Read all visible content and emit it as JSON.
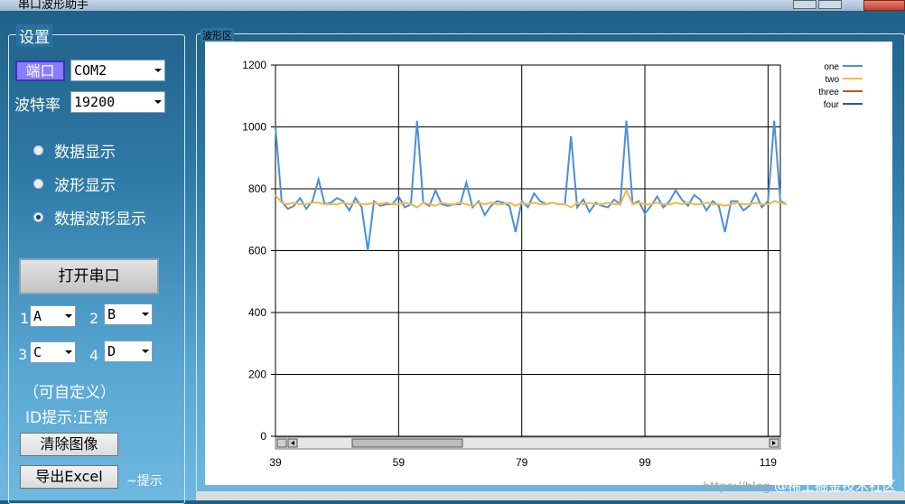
{
  "window": {
    "title": "串口波形助手"
  },
  "settings": {
    "legend": "设置",
    "port_button": "端口",
    "port_value": "COM2",
    "baud_label": "波特率",
    "baud_value": "19200",
    "radios": [
      {
        "label": "数据显示",
        "checked": false
      },
      {
        "label": "波形显示",
        "checked": false
      },
      {
        "label": "数据波形显示",
        "checked": true
      }
    ],
    "open_button": "打开串口",
    "channels": [
      {
        "num": "1",
        "value": "A"
      },
      {
        "num": "2",
        "value": "B"
      },
      {
        "num": "3",
        "value": "C"
      },
      {
        "num": "4",
        "value": "D"
      }
    ],
    "custom_note": "（可自定义）",
    "id_hint": "ID提示:正常",
    "clear_button": "清除图像",
    "export_button": "导出Excel",
    "tip_text": "~提示"
  },
  "waveform": {
    "legend": "波形区"
  },
  "watermark": {
    "url": "https://blog",
    "brand": "@稀土掘金技术社区"
  },
  "colors": {
    "one": "#4a90d9",
    "two": "#f5b942",
    "three": "#c8501e",
    "four": "#1f5f96"
  },
  "chart_data": {
    "type": "line",
    "x_ticks": [
      39,
      59,
      79,
      99,
      119
    ],
    "y_ticks": [
      0,
      200,
      400,
      600,
      800,
      1000,
      1200
    ],
    "xlim": [
      39,
      121
    ],
    "ylim": [
      0,
      1200
    ],
    "grid": true,
    "legend_position": "top-right",
    "series": [
      {
        "name": "one",
        "color": "#4a90d9",
        "values": [
          1000,
          760,
          735,
          745,
          770,
          735,
          760,
          830,
          750,
          755,
          770,
          760,
          730,
          770,
          740,
          600,
          760,
          745,
          750,
          750,
          775,
          740,
          750,
          1020,
          755,
          745,
          795,
          750,
          745,
          750,
          750,
          820,
          740,
          760,
          715,
          745,
          760,
          755,
          745,
          660,
          760,
          740,
          785,
          760,
          750,
          755,
          750,
          750,
          970,
          740,
          765,
          725,
          755,
          745,
          740,
          765,
          750,
          1020,
          750,
          760,
          720,
          745,
          775,
          740,
          760,
          795,
          765,
          745,
          780,
          765,
          730,
          760,
          745,
          660,
          760,
          760,
          730,
          745,
          785,
          740,
          760,
          1020,
          760,
          750
        ]
      },
      {
        "name": "two",
        "color": "#f5b942",
        "values": [
          780,
          755,
          750,
          755,
          750,
          750,
          755,
          755,
          750,
          750,
          750,
          755,
          750,
          755,
          750,
          750,
          755,
          750,
          755,
          750,
          750,
          755,
          750,
          740,
          755,
          750,
          745,
          755,
          750,
          750,
          755,
          750,
          745,
          755,
          750,
          755,
          750,
          750,
          755,
          745,
          755,
          750,
          755,
          750,
          750,
          755,
          750,
          750,
          740,
          755,
          750,
          755,
          750,
          750,
          755,
          750,
          750,
          795,
          750,
          755,
          750,
          750,
          755,
          750,
          750,
          755,
          750,
          755,
          750,
          750,
          755,
          750,
          750,
          745,
          750,
          755,
          750,
          750,
          755,
          750,
          750,
          760,
          755,
          750
        ]
      },
      {
        "name": "three",
        "color": "#c8501e",
        "values": []
      },
      {
        "name": "four",
        "color": "#1f5f96",
        "values": []
      }
    ]
  }
}
